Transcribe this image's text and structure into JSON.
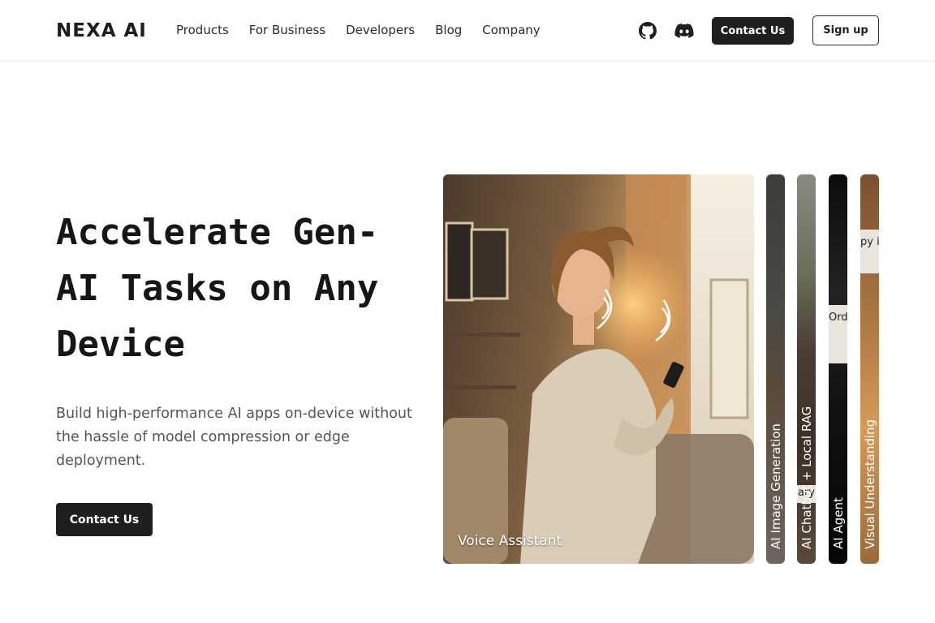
{
  "header": {
    "logo": "NEXA AI",
    "nav": [
      "Products",
      "For Business",
      "Developers",
      "Blog",
      "Company"
    ],
    "icons": [
      "github-icon",
      "discord-icon"
    ],
    "contact_label": "Contact Us",
    "signup_label": "Sign up"
  },
  "hero": {
    "title": "Accelerate Gen-AI Tasks on Any Device",
    "subtitle": "Build high-performance AI apps on-device without the hassle of model compression or edge deployment.",
    "cta_label": "Contact Us"
  },
  "showcase": {
    "main_card_label": "Voice Assistant",
    "side_cards": [
      {
        "label": "AI Image Generation"
      },
      {
        "label": "AI Chatbot + Local RAG",
        "fragment": "ary"
      },
      {
        "label": "AI Agent",
        "fragment": "Orde from deliv"
      },
      {
        "label": "Visual Understanding",
        "fragment": "py is y."
      }
    ]
  },
  "colors": {
    "primary_button": "#1f1f1f",
    "text_primary": "#161616",
    "text_secondary": "#555555"
  }
}
